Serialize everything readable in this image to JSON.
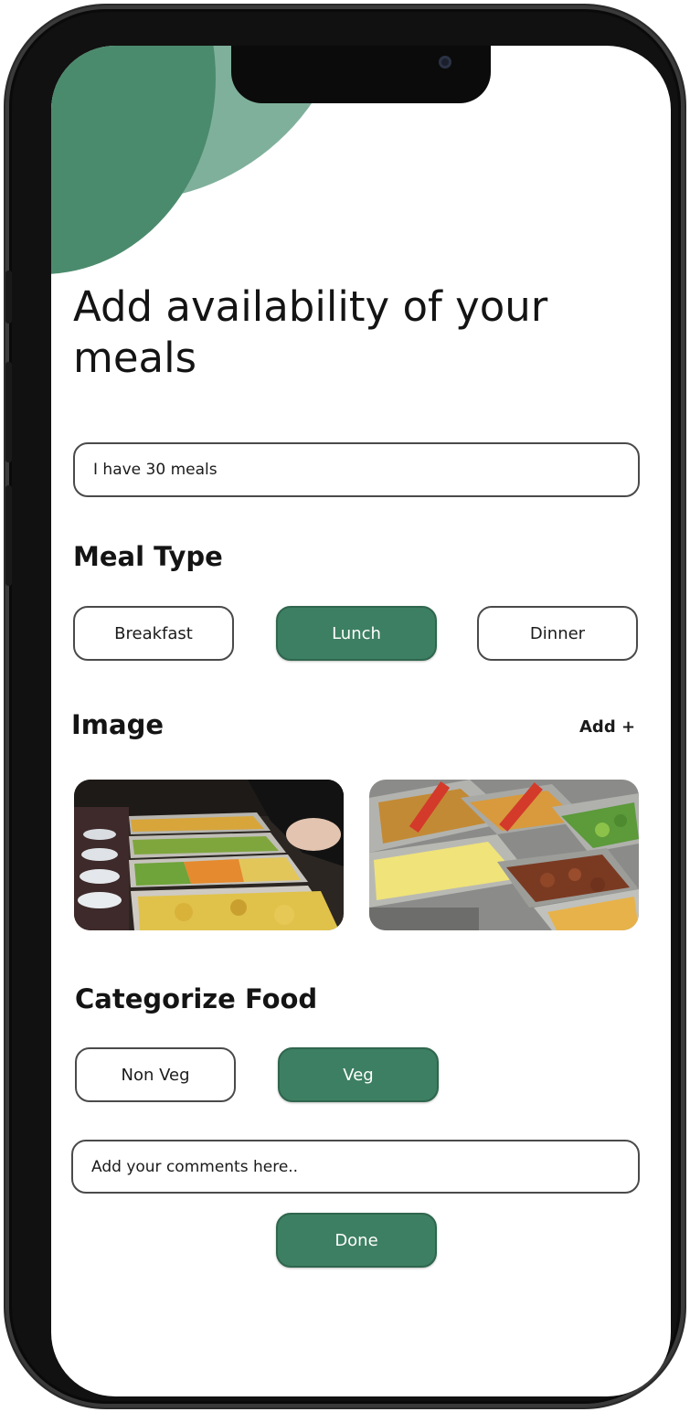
{
  "title": "Add availability of your meals",
  "meals_input": {
    "value": "I have 30 meals"
  },
  "meal_type": {
    "title": "Meal Type",
    "options": [
      "Breakfast",
      "Lunch",
      "Dinner"
    ],
    "selected": "Lunch"
  },
  "image_section": {
    "title": "Image",
    "add_label": "Add +",
    "images": [
      {
        "name": "buffet-trays-photo"
      },
      {
        "name": "serving-tongs-trays-photo"
      }
    ]
  },
  "categorize": {
    "title": "Categorize Food",
    "options": [
      "Non Veg",
      "Veg"
    ],
    "selected": "Veg"
  },
  "comments_input": {
    "placeholder": "Add your comments here.."
  },
  "done_label": "Done",
  "colors": {
    "accent": "#3d7f62",
    "circle_dark": "#4b8b6d",
    "circle_light": "#86b7a2"
  }
}
